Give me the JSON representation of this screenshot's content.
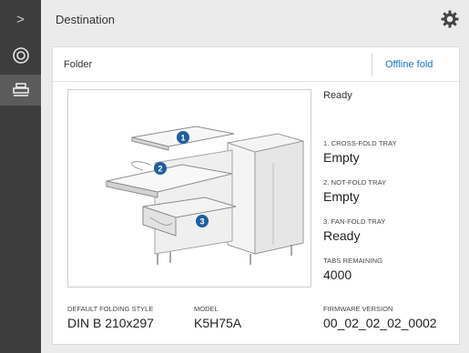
{
  "sidebar": {
    "chevron": ">",
    "icons": [
      "chevron-right-icon",
      "target-icon",
      "printer-icon"
    ]
  },
  "header": {
    "title": "Destination",
    "settings_icon": "gear-icon"
  },
  "folder": {
    "title": "Folder",
    "offline_label": "Offline fold",
    "status": "Ready",
    "trays": [
      {
        "label": "1. CROSS-FOLD TRAY",
        "value": "Empty"
      },
      {
        "label": "2. NOT-FOLD TRAY",
        "value": "Empty"
      },
      {
        "label": "3. FAN-FOLD TRAY",
        "value": "Ready"
      }
    ],
    "tabs_remaining": {
      "label": "TABS REMAINING",
      "value": "4000"
    },
    "default_style": {
      "label": "DEFAULT FOLDING STYLE",
      "value": "DIN B 210x297"
    },
    "model": {
      "label": "MODEL",
      "value": "K5H75A"
    },
    "firmware": {
      "label": "FIRMWARE VERSION",
      "value": "00_02_02_02_0002"
    },
    "markers": [
      "1",
      "2",
      "3"
    ]
  },
  "colors": {
    "sidebar": "#3d3d3d",
    "accent_link": "#1a73c9",
    "marker": "#1f5f9e",
    "background": "#ebebeb"
  }
}
